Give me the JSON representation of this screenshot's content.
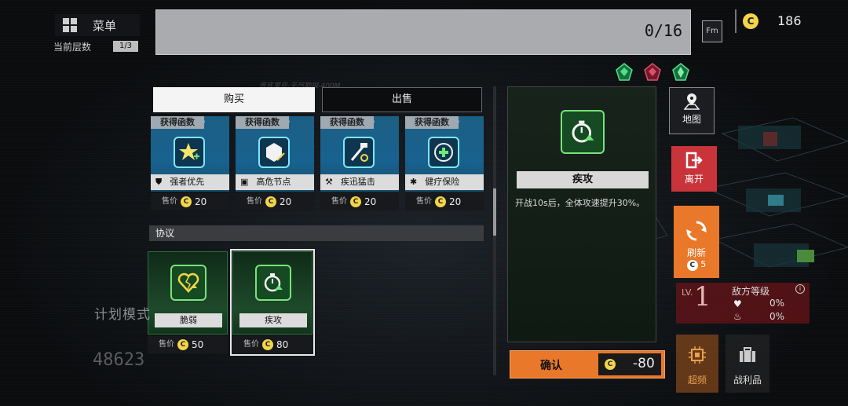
{
  "top": {
    "menu_label": "菜单",
    "floor_label": "当前层数",
    "floor_value": "1/3",
    "capacity": "0/16",
    "coins": "186",
    "fm_icon": "Fm",
    "depth_text": "庞底里亚-无尽勘探-400M"
  },
  "tabs": {
    "buy": "购买",
    "sell": "出售"
  },
  "section_tag": "获得函数",
  "functions": [
    {
      "name": "强者优先",
      "price_label": "售价",
      "price": "20"
    },
    {
      "name": "高危节点",
      "price_label": "售价",
      "price": "20"
    },
    {
      "name": "疾迅猛击",
      "price_label": "售价",
      "price": "20"
    },
    {
      "name": "健疗保险",
      "price_label": "售价",
      "price": "20"
    }
  ],
  "protocol_label": "协议",
  "protocols": [
    {
      "name": "脆弱",
      "price_label": "售价",
      "price": "50"
    },
    {
      "name": "疾攻",
      "price_label": "售价",
      "price": "80"
    }
  ],
  "detail": {
    "title": "疾攻",
    "description": "开战10s后，全体攻速提升30%。"
  },
  "confirm": {
    "label": "确认",
    "cost": "-80"
  },
  "side": {
    "map": "地图",
    "leave": "离开",
    "refresh": "刷新",
    "refresh_cost": "5",
    "level_prefix": "LV.",
    "level": "1",
    "enemy_level_label": "敌方等级",
    "hp_pct": "0%",
    "atk_pct": "0%",
    "overclock": "超频",
    "loot": "战利品"
  },
  "background": {
    "plan_mode": "计划模式",
    "number": "48623"
  },
  "colors": {
    "accent_orange": "#e9782a",
    "leave_red": "#c9343a",
    "function_blue": "#17628f",
    "protocol_green": "#1e4a2b",
    "coin_yellow": "#f2d54a"
  }
}
